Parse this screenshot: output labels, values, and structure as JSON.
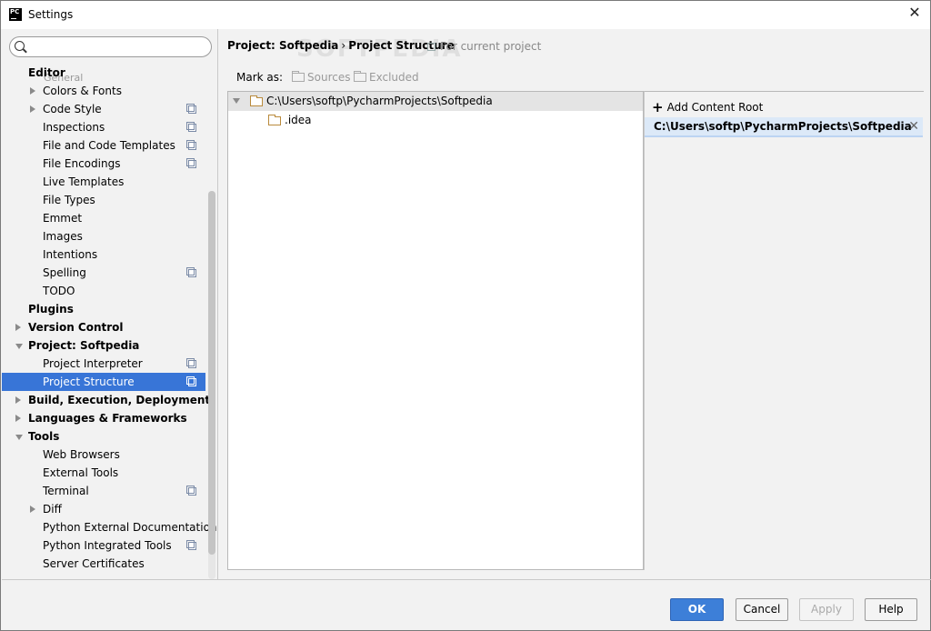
{
  "window": {
    "title": "Settings",
    "app_icon": "PC"
  },
  "search": {
    "placeholder": ""
  },
  "sidebar": {
    "faded_item": "General",
    "items": [
      {
        "label": "Editor",
        "bold": true,
        "indent": 0,
        "arrow": "none"
      },
      {
        "label": "Colors & Fonts",
        "indent": 1,
        "arrow": "right"
      },
      {
        "label": "Code Style",
        "indent": 1,
        "arrow": "right",
        "copy": true
      },
      {
        "label": "Inspections",
        "indent": 1,
        "copy": true
      },
      {
        "label": "File and Code Templates",
        "indent": 1,
        "copy": true
      },
      {
        "label": "File Encodings",
        "indent": 1,
        "copy": true
      },
      {
        "label": "Live Templates",
        "indent": 1
      },
      {
        "label": "File Types",
        "indent": 1
      },
      {
        "label": "Emmet",
        "indent": 1
      },
      {
        "label": "Images",
        "indent": 1
      },
      {
        "label": "Intentions",
        "indent": 1
      },
      {
        "label": "Spelling",
        "indent": 1,
        "copy": true
      },
      {
        "label": "TODO",
        "indent": 1
      },
      {
        "label": "Plugins",
        "bold": true,
        "indent": 0
      },
      {
        "label": "Version Control",
        "bold": true,
        "indent": 0,
        "arrow": "right"
      },
      {
        "label": "Project: Softpedia",
        "bold": true,
        "indent": 0,
        "arrow": "down"
      },
      {
        "label": "Project Interpreter",
        "indent": 1,
        "copy": true
      },
      {
        "label": "Project Structure",
        "indent": 1,
        "copy": true,
        "selected": true
      },
      {
        "label": "Build, Execution, Deployment",
        "bold": true,
        "indent": 0,
        "arrow": "right"
      },
      {
        "label": "Languages & Frameworks",
        "bold": true,
        "indent": 0,
        "arrow": "right"
      },
      {
        "label": "Tools",
        "bold": true,
        "indent": 0,
        "arrow": "down"
      },
      {
        "label": "Web Browsers",
        "indent": 1
      },
      {
        "label": "External Tools",
        "indent": 1
      },
      {
        "label": "Terminal",
        "indent": 1,
        "copy": true
      },
      {
        "label": "Diff",
        "indent": 1,
        "arrow": "right"
      },
      {
        "label": "Python External Documentation",
        "indent": 1
      },
      {
        "label": "Python Integrated Tools",
        "indent": 1,
        "copy": true
      },
      {
        "label": "Server Certificates",
        "indent": 1
      }
    ]
  },
  "breadcrumb": {
    "project": "Project: Softpedia",
    "separator": "›",
    "page": "Project Structure"
  },
  "scope": {
    "label": "For current project"
  },
  "watermark": "SOFTPEDIA",
  "mark_as": {
    "label": "Mark as:",
    "sources": "Sources",
    "excluded": "Excluded"
  },
  "file_tree": {
    "root": "C:\\Users\\softp\\PycharmProjects\\Softpedia",
    "children": [
      ".idea"
    ]
  },
  "content_roots": {
    "add_label": "Add Content Root",
    "entries": [
      "C:\\Users\\softp\\PycharmProjects\\Softpedia"
    ]
  },
  "buttons": {
    "ok": "OK",
    "cancel": "Cancel",
    "apply": "Apply",
    "help": "Help"
  },
  "colors": {
    "selection": "#3875d7",
    "ok_button": "#3d7fd8",
    "folder": "#b98a3c",
    "root_entry_bg": "#dce9f8"
  }
}
